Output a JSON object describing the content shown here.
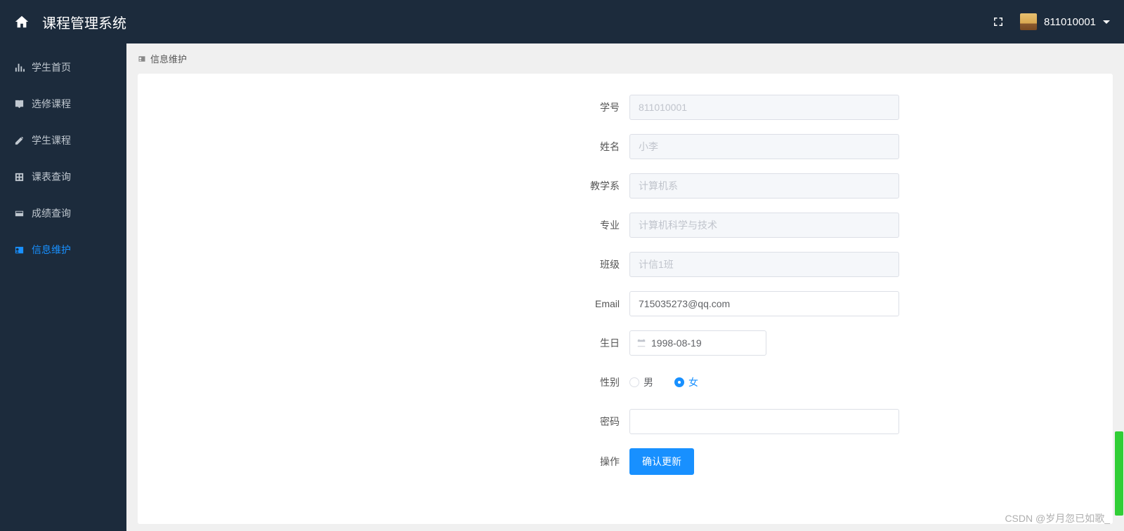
{
  "header": {
    "title": "课程管理系统",
    "username": "811010001"
  },
  "sidebar": {
    "items": [
      {
        "label": "学生首页",
        "icon": "chart"
      },
      {
        "label": "选修课程",
        "icon": "book"
      },
      {
        "label": "学生课程",
        "icon": "edit"
      },
      {
        "label": "课表查询",
        "icon": "table"
      },
      {
        "label": "成绩查询",
        "icon": "card"
      },
      {
        "label": "信息维护",
        "icon": "id"
      }
    ],
    "active_index": 5
  },
  "breadcrumb": {
    "label": "信息维护"
  },
  "form": {
    "student_id": {
      "label": "学号",
      "value": "811010001"
    },
    "name": {
      "label": "姓名",
      "value": "小李"
    },
    "department": {
      "label": "教学系",
      "value": "计算机系"
    },
    "major": {
      "label": "专业",
      "value": "计算机科学与技术"
    },
    "class": {
      "label": "班级",
      "value": "计信1班"
    },
    "email": {
      "label": "Email",
      "value": "715035273@qq.com"
    },
    "birthday": {
      "label": "生日",
      "value": "1998-08-19"
    },
    "gender": {
      "label": "性别",
      "options": {
        "male": "男",
        "female": "女"
      },
      "selected": "female"
    },
    "password": {
      "label": "密码",
      "value": ""
    },
    "action": {
      "label": "操作",
      "button": "确认更新"
    }
  },
  "watermark": "CSDN @岁月忽已如歌_"
}
